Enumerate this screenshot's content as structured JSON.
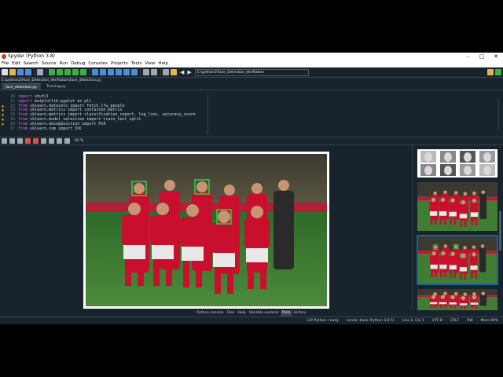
{
  "window": {
    "title": "Spyder (Python 3.8)"
  },
  "titlebar": {
    "min": "–",
    "max": "▢",
    "close": "✕"
  },
  "menubar": [
    "File",
    "Edit",
    "Search",
    "Source",
    "Run",
    "Debug",
    "Consoles",
    "Projects",
    "Tools",
    "View",
    "Help"
  ],
  "toolbar": {
    "path": "E:\\python2\\Face_Detection_Verifiation",
    "back": "◀",
    "forward": "▶",
    "folder_icon": "folder-icon"
  },
  "filepath": "E:\\python2\\Face_Detection_Verifiation\\face_detection.py",
  "editor_tabs": [
    {
      "label": "face_detection.py",
      "active": true
    },
    {
      "label": "Training.py",
      "active": false
    }
  ],
  "code_lines": [
    {
      "num": "10",
      "warn": "",
      "kw": "import",
      "rest": " shutil"
    },
    {
      "num": "11",
      "warn": "",
      "kw": "import",
      "rest": " matplotlib.pyplot as plt"
    },
    {
      "num": "12",
      "warn": "▲",
      "kw": "from",
      "rest": " sklearn.datasets import fetch_lfw_people"
    },
    {
      "num": "13",
      "warn": "▲",
      "kw": "from",
      "rest": " sklearn.metrics import confusion_matrix"
    },
    {
      "num": "14",
      "warn": "▲",
      "kw": "from",
      "rest": " sklearn.metrics import classification_report, log_loss, accuracy_score"
    },
    {
      "num": "15",
      "warn": "▲",
      "kw": "from",
      "rest": " sklearn.model_selection import train_test_split"
    },
    {
      "num": "16",
      "warn": "▲",
      "kw": "from",
      "rest": " sklearn.decomposition import PCA"
    },
    {
      "num": "17",
      "warn": "",
      "kw": "from",
      "rest": " sklearn.svm import SVC"
    }
  ],
  "plots_toolbar": {
    "zoom": "92 %"
  },
  "pane_tabs": [
    {
      "label": "Python console",
      "active": false
    },
    {
      "label": "Files",
      "active": false
    },
    {
      "label": "Help",
      "active": false
    },
    {
      "label": "Variable explorer",
      "active": false
    },
    {
      "label": "Plots",
      "active": true
    },
    {
      "label": "History",
      "active": false
    }
  ],
  "statusbar": {
    "lsp": "LSP Python: ready",
    "conda": "conda: base (Python 3.8.5)",
    "position": "Line 1, Col 1",
    "encoding": "UTF-8",
    "eol": "CRLF",
    "perm": "RW",
    "mem": "Mem 89%"
  },
  "colors": {
    "bg": "#19232d",
    "accent": "#1464a0",
    "face_box": "#2ecc40",
    "jersey": "#c8102e"
  }
}
